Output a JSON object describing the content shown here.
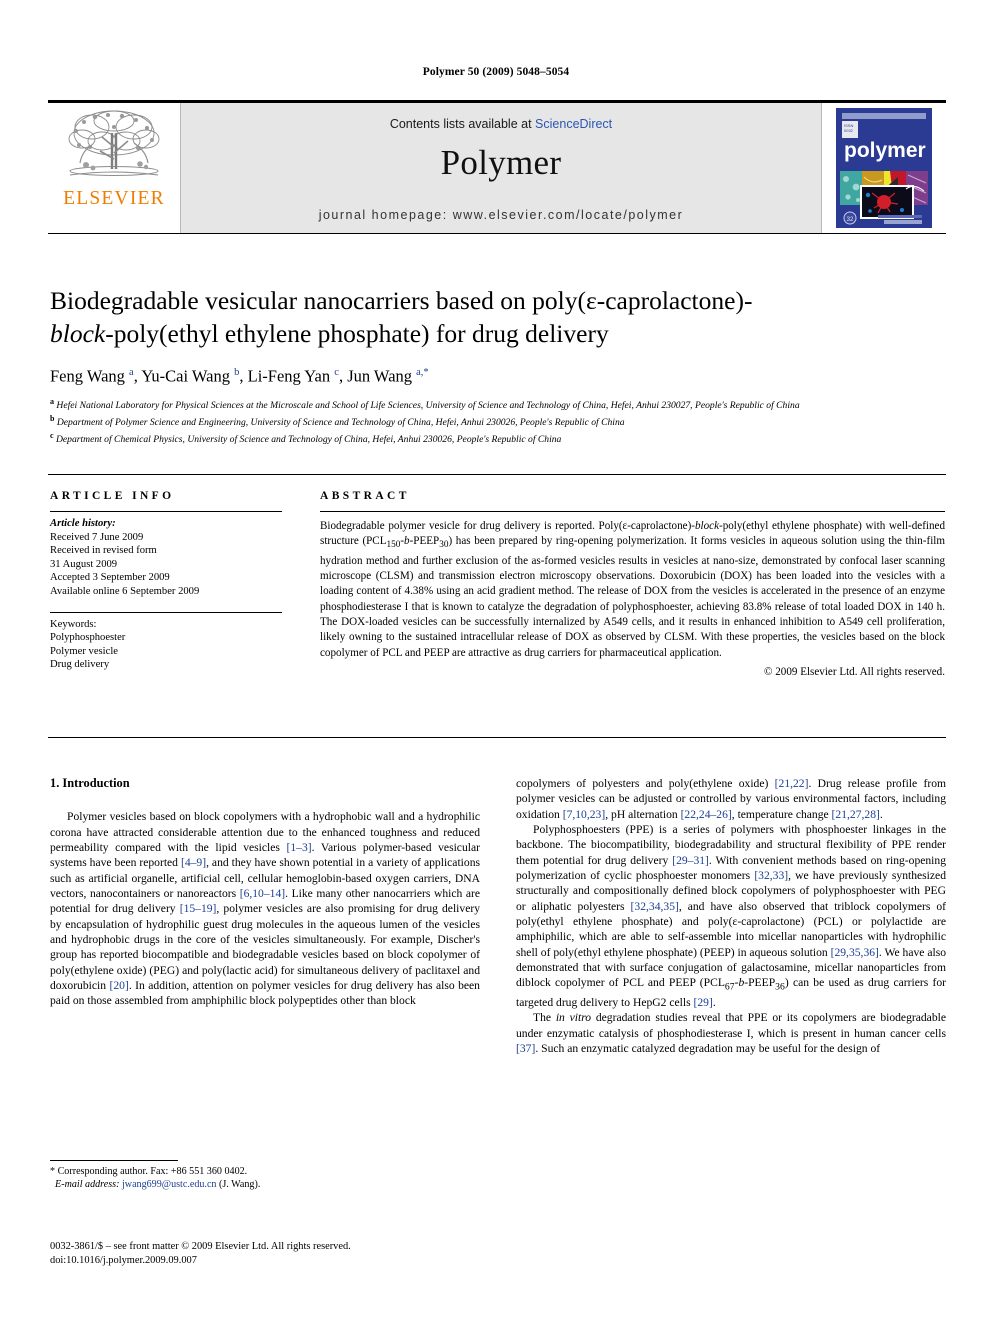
{
  "running_head": "Polymer 50 (2009) 5048–5054",
  "masthead": {
    "publisher_logo_label": "ELSEVIER",
    "contents_prefix": "Contents lists available at",
    "contents_link": "ScienceDirect",
    "journal_name": "Polymer",
    "homepage": "journal homepage: www.elsevier.com/locate/polymer",
    "cover_title": "polymer"
  },
  "article": {
    "title_line1": "Biodegradable vesicular nanocarriers based on poly(ε-caprolactone)-",
    "title_block_italic": "block",
    "title_line2_rest": "-poly(ethyl ethylene phosphate) for drug delivery",
    "authors": "Feng Wang a, Yu-Cai Wang b, Li-Feng Yan c, Jun Wang a,*",
    "affiliations": [
      "a Hefei National Laboratory for Physical Sciences at the Microscale and School of Life Sciences, University of Science and Technology of China, Hefei, Anhui 230027, People's Republic of China",
      "b Department of Polymer Science and Engineering, University of Science and Technology of China, Hefei, Anhui 230026, People's Republic of China",
      "c Department of Chemical Physics, University of Science and Technology of China, Hefei, Anhui 230026, People's Republic of China"
    ]
  },
  "info": {
    "heading": "ARTICLE INFO",
    "history_label": "Article history:",
    "history": [
      "Received 7 June 2009",
      "Received in revised form",
      "31 August 2009",
      "Accepted 3 September 2009",
      "Available online 6 September 2009"
    ],
    "keywords_label": "Keywords:",
    "keywords": [
      "Polyphosphoester",
      "Polymer vesicle",
      "Drug delivery"
    ]
  },
  "abstract": {
    "heading": "ABSTRACT",
    "paragraph_1": "Biodegradable polymer vesicle for drug delivery is reported. Poly(ε-caprolactone)-",
    "block_italic": "block",
    "paragraph_2": "-poly(ethyl ethylene phosphate) with well-defined structure (PCL",
    "sub_150": "150",
    "dash_b": "-b-",
    "peep": "PEEP",
    "sub_30": "30",
    "paragraph_3": ") has been prepared by ring-opening polymerization. It forms vesicles in aqueous solution using the thin-film hydration method and further exclusion of the as-formed vesicles results in vesicles at nano-size, demonstrated by confocal laser scanning microscope (CLSM) and transmission electron microscopy observations. Doxorubicin (DOX) has been loaded into the vesicles with a loading content of 4.38% using an acid gradient method. The release of DOX from the vesicles is accelerated in the presence of an enzyme phosphodiesterase I that is known to catalyze the degradation of polyphosphoester, achieving 83.8% release of total loaded DOX in 140 h. The DOX-loaded vesicles can be successfully internalized by A549 cells, and it results in enhanced inhibition to A549 cell proliferation, likely owning to the sustained intracellular release of DOX as observed by CLSM. With these properties, the vesicles based on the block copolymer of PCL and PEEP are attractive as drug carriers for pharmaceutical application.",
    "copyright": "© 2009 Elsevier Ltd. All rights reserved."
  },
  "body": {
    "section_heading": "1. Introduction",
    "left_paragraphs": [
      {
        "part1": "Polymer vesicles based on block copolymers with a hydrophobic wall and a hydrophilic corona have attracted considerable attention due to the enhanced toughness and reduced permeability compared with the lipid vesicles ",
        "cite1": "[1–3]",
        "part2": ". Various polymer-based vesicular systems have been reported ",
        "cite2": "[4–9]",
        "part3": ", and they have shown potential in a variety of applications such as artificial organelle, artificial cell, cellular hemoglobin-based oxygen carriers, DNA vectors, nanocontainers or nanoreactors ",
        "cite3": "[6,10–14]",
        "part4": ". Like many other nanocarriers which are potential for drug delivery ",
        "cite4": "[15–19]",
        "part5": ", polymer vesicles are also promising for drug delivery by encapsulation of hydrophilic guest drug molecules in the aqueous lumen of the vesicles and hydrophobic drugs in the core of the vesicles simultaneously. For example, Discher's group has reported biocompatible and biodegradable vesicles based on block copolymer of poly(ethylene oxide) (PEG) and poly(lactic acid) for simultaneous delivery of paclitaxel and doxorubicin ",
        "cite5": "[20]",
        "part6": ". In addition, attention on polymer vesicles for drug delivery has also been paid on those assembled from amphiphilic block polypeptides other than block"
      }
    ],
    "right_paragraphs": {
      "p1_part1": "copolymers of polyesters and poly(ethylene oxide) ",
      "p1_cite1": "[21,22]",
      "p1_part2": ". Drug release profile from polymer vesicles can be adjusted or controlled by various environmental factors, including oxidation ",
      "p1_cite2": "[7,10,23]",
      "p1_part3": ", pH alternation ",
      "p1_cite3": "[22,24–26]",
      "p1_part4": ", temperature change ",
      "p1_cite4": "[21,27,28]",
      "p1_part5": ".",
      "p2_part1": "Polyphosphoesters (PPE) is a series of polymers with phosphoester linkages in the backbone. The biocompatibility, biodegradability and structural flexibility of PPE render them potential for drug delivery ",
      "p2_cite1": "[29–31]",
      "p2_part2": ". With convenient methods based on ring-opening polymerization of cyclic phosphoester monomers ",
      "p2_cite2": "[32,33]",
      "p2_part3": ", we have previously synthesized structurally and compositionally defined block copolymers of polyphosphoester with PEG or aliphatic polyesters ",
      "p2_cite3": "[32,34,35]",
      "p2_part4": ", and have also observed that triblock copolymers of poly(ethyl ethylene phosphate) and poly(ε-caprolactone) (PCL) or polylactide are amphiphilic, which are able to self-assemble into micellar nanoparticles with hydrophilic shell of poly(ethyl ethylene phosphate) (PEEP) in aqueous solution ",
      "p2_cite4": "[29,35,36]",
      "p2_part5": ". We have also demonstrated that with surface conjugation of galactosamine, micellar nanoparticles from diblock copolymer of PCL and PEEP (PCL",
      "p2_sub67": "67",
      "p2_bmid": "-b-",
      "p2_peep": "PEEP",
      "p2_sub36": "36",
      "p2_part6": ") can be used as drug carriers for targeted drug delivery to HepG2 cells ",
      "p2_cite5": "[29]",
      "p2_part7": ".",
      "p3_part1": "The ",
      "p3_italic": "in vitro",
      "p3_part2": " degradation studies reveal that PPE or its copolymers are biodegradable under enzymatic catalysis of phosphodiesterase I, which is present in human cancer cells ",
      "p3_cite1": "[37]",
      "p3_part3": ". Such an enzymatic catalyzed degradation may be useful for the design of"
    }
  },
  "footnote": {
    "corresponding": "* Corresponding author. Fax: +86 551 360 0402.",
    "email_label": "E-mail address:",
    "email": "jwang699@ustc.edu.cn",
    "email_suffix": "(J. Wang)."
  },
  "footer": {
    "issn_line": "0032-3861/$ – see front matter © 2009 Elsevier Ltd. All rights reserved.",
    "doi_line": "doi:10.1016/j.polymer.2009.09.007"
  },
  "colors": {
    "link_blue": "#2b56b0",
    "citation_blue": "#1c3f94",
    "elsevier_orange": "#f07d00",
    "masthead_grey": "#e6e6e6",
    "cover_blue": "#2b3a92"
  }
}
